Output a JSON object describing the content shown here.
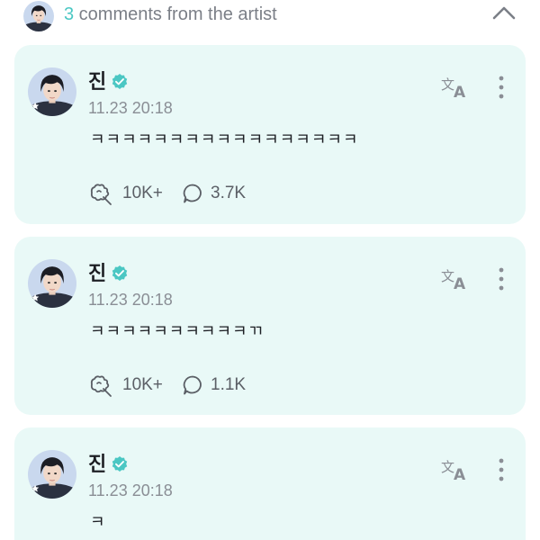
{
  "header": {
    "count": "3",
    "label": " comments from the artist",
    "collapse_icon": "chevron-up-icon"
  },
  "colors": {
    "accent": "#4bc7c3",
    "card_background": "#e9f9f7",
    "verified": "#4bc7c3"
  },
  "comments": [
    {
      "author": "진",
      "verified_icon": "verified-badge-icon",
      "timestamp": "11.23 20:18",
      "text": "ㅋㅋㅋㅋㅋㅋㅋㅋㅋㅋㅋㅋㅋㅋㅋㅋㅋ",
      "likes": "10K+",
      "replies": "3.7K"
    },
    {
      "author": "진",
      "verified_icon": "verified-badge-icon",
      "timestamp": "11.23 20:18",
      "text": "ㅋㅋㅋㅋㅋㅋㅋㅋㅋㅋㄲ",
      "likes": "10K+",
      "replies": "1.1K"
    },
    {
      "author": "진",
      "verified_icon": "verified-badge-icon",
      "timestamp": "11.23 20:18",
      "text": "ㅋ"
    }
  ]
}
